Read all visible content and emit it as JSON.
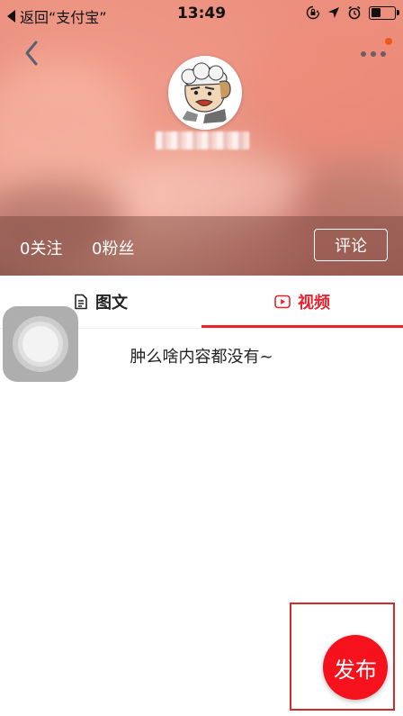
{
  "status_bar": {
    "back_label": "返回“支付宝”",
    "time": "13:49",
    "icons": [
      "orientation-lock-icon",
      "location-arrow-icon",
      "alarm-icon",
      "battery-icon"
    ]
  },
  "header": {
    "back_icon": "chevron-left-icon",
    "more_icon": "more-dots-icon",
    "notification_color": "#f25a14"
  },
  "profile": {
    "avatar_icon": "cartoon-avatar",
    "username_obscured": true
  },
  "stats": {
    "following": "0关注",
    "followers": "0粉丝",
    "comment_button": "评论"
  },
  "tabs": [
    {
      "label": "图文",
      "icon": "document-icon",
      "active": false
    },
    {
      "label": "视频",
      "icon": "video-play-icon",
      "active": true
    }
  ],
  "empty_message": "肿么啥内容都没有~",
  "publish_button": "发布",
  "colors": {
    "accent": "#e8222e",
    "publish": "#f5121d",
    "tab_inactive": "#222222",
    "tab_active": "#e8222e"
  }
}
